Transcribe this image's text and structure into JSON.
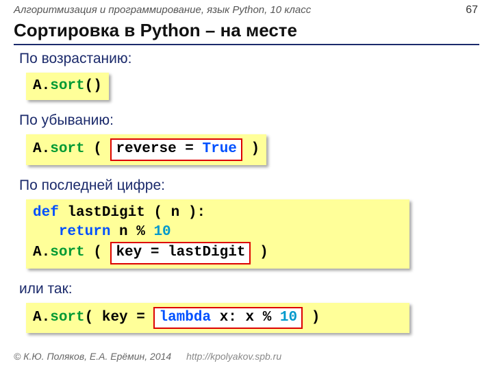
{
  "header": "Алгоритмизация и программирование, язык Python, 10 класс",
  "page_num": "67",
  "title": "Сортировка в Python – на месте",
  "sections": {
    "asc_label": "По возрастанию:",
    "desc_label": "По убыванию:",
    "lastdigit_label": "По последней цифре:",
    "alt_label": "или так:"
  },
  "code": {
    "asc": {
      "a": "A.",
      "sort": "sort",
      "paren": "()"
    },
    "desc": {
      "a": "A.",
      "sort": "sort",
      "open": " ( ",
      "arg_l": "reverse",
      "arg_eq": " = ",
      "arg_r": "True",
      "close": " )"
    },
    "lastdigit": {
      "def": "def",
      "fn_sp": " lastDigit ( n ):",
      "indent": "   ",
      "return": "return",
      "expr_l": " n % ",
      "ten": "10",
      "a": "A.",
      "sort": "sort",
      "open": " ( ",
      "arg": "key = lastDigit",
      "close": " )"
    },
    "lambda": {
      "a": "A.",
      "sort": "sort",
      "open": "( key = ",
      "box_l": "lambda",
      "box_mid": " x: x % ",
      "box_num": "10",
      "close": " )"
    }
  },
  "footer": {
    "copyright": "© К.Ю. Поляков, Е.А. Ерёмин, 2014",
    "url": "http://kpolyakov.spb.ru"
  }
}
